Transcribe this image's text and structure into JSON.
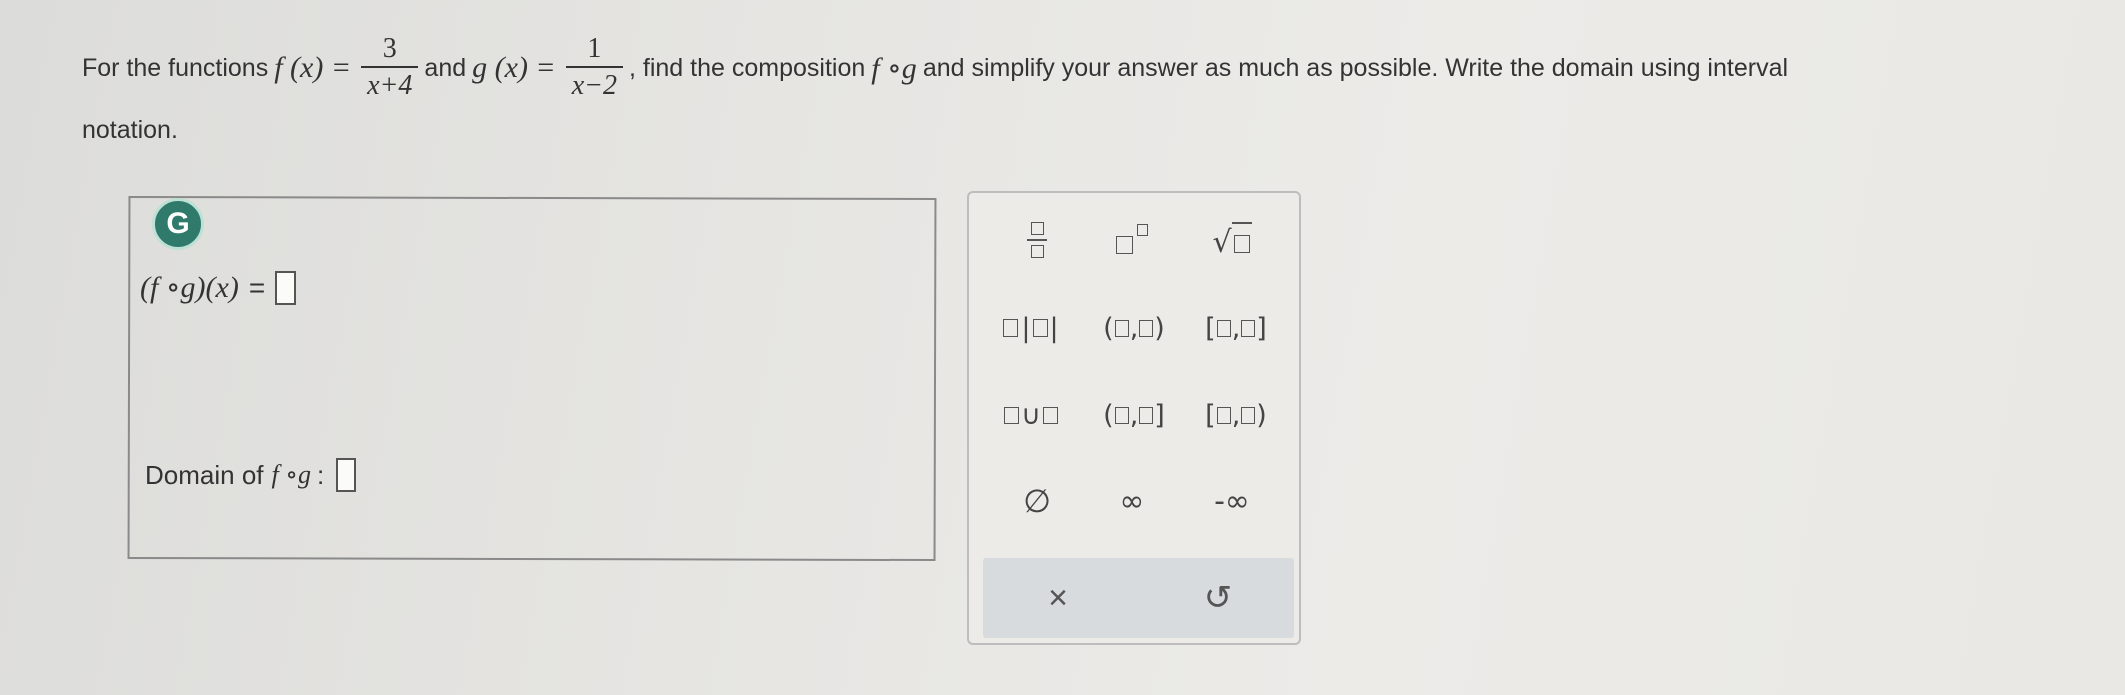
{
  "question": {
    "lead": "For the functions",
    "f_lhs": "f (x) =",
    "f_num": "3",
    "f_den": "x+4",
    "and": "and",
    "g_lhs": "g (x) =",
    "g_num": "1",
    "g_den": "x−2",
    "mid": ", find the composition",
    "comp": "f ∘g",
    "tail": "and simplify your answer as much as possible. Write the domain using interval",
    "line2": "notation."
  },
  "answer": {
    "badge": "G",
    "composition_label": "(f ∘g)(x)",
    "equals": "=",
    "domain_label": "Domain of",
    "domain_fn": "f ∘g",
    "domain_colon": ":"
  },
  "palette": {
    "abs_bar": "|",
    "open_open": [
      "(",
      ",",
      ")"
    ],
    "closed_closed": [
      "[",
      ",",
      "]"
    ],
    "union": "∪",
    "open_closed": [
      "(",
      ",",
      "]"
    ],
    "closed_open": [
      "[",
      ",",
      ")"
    ],
    "empty_set": "∅",
    "infinity": "∞",
    "neg_infinity": "-∞",
    "clear": "×",
    "undo": "↺"
  }
}
